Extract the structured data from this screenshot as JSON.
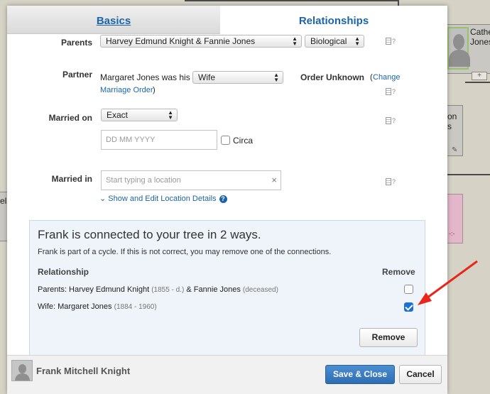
{
  "background": {
    "card_top_right_name_line1": "Cathe",
    "card_top_right_name_line2": "Jones",
    "card_mid_right_line1": "on",
    "card_mid_right_line2": "s",
    "card_left_text": "el"
  },
  "tabs": [
    {
      "label": "Basics",
      "active": false
    },
    {
      "label": "Relationships",
      "active": true
    }
  ],
  "form": {
    "parents": {
      "label": "Parents",
      "value": "Harvey Edmund Knight & Fannie Jones",
      "type_value": "Biological"
    },
    "partner": {
      "label": "Partner",
      "prefix_text": "Margaret Jones was his",
      "relation_value": "Wife",
      "order_status": "Order Unknown",
      "change_link_line1": "Change",
      "change_link_line2": "Marriage Order",
      "paren_open": "(",
      "paren_close": ")"
    },
    "married_on": {
      "label": "Married on",
      "qualifier_value": "Exact",
      "date_placeholder": "DD MM YYYY",
      "circa_label": "Circa"
    },
    "married_in": {
      "label": "Married in",
      "location_placeholder": "Start typing a location",
      "clear_glyph": "×",
      "details_link": "Show and Edit Location Details",
      "details_chevron": "⌄"
    },
    "help_glyph": "?"
  },
  "cycle_notice": {
    "title": "Frank is connected to your tree in 2 ways.",
    "subtitle": "Frank is part of a cycle. If this is not correct, you may remove one of the connections.",
    "col_relationship": "Relationship",
    "col_remove": "Remove",
    "rows": [
      {
        "relation": "Parents: Harvey Edmund Knight",
        "dates1": "(1855 - d.)",
        "joiner": "& Fannie Jones",
        "dates2": "(deceased)",
        "checked": false
      },
      {
        "relation": "Wife: Margaret Jones",
        "dates1": "(1884 - 1960)",
        "checked": true
      }
    ],
    "remove_button": "Remove"
  },
  "footer": {
    "person_name": "Frank Mitchell Knight",
    "save_button": "Save & Close",
    "cancel_button": "Cancel"
  },
  "colors": {
    "link": "#1b64a8",
    "primary_button": "#3a7cc2",
    "annotation_arrow": "#e8261c",
    "notice_bg": "#eef4fa"
  }
}
